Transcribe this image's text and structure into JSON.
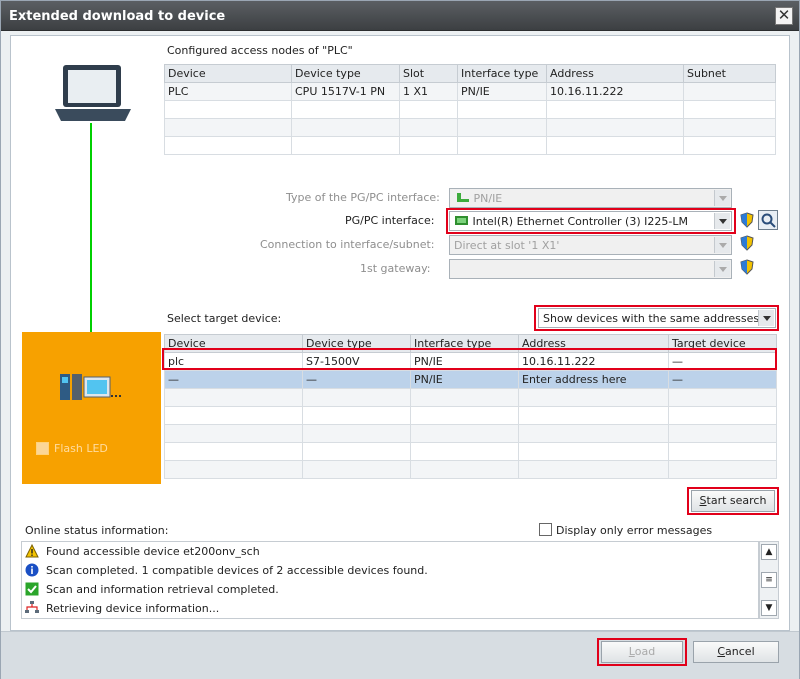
{
  "window": {
    "title": "Extended download to device",
    "close_glyph": "✕"
  },
  "configured": {
    "heading": "Configured access nodes of \"PLC\"",
    "columns": [
      "Device",
      "Device type",
      "Slot",
      "Interface type",
      "Address",
      "Subnet"
    ],
    "rows": [
      [
        "PLC",
        "CPU 1517V-1 PN",
        "1 X1",
        "PN/IE",
        "10.16.11.222",
        ""
      ]
    ]
  },
  "interface": {
    "type_label": "Type of the PG/PC interface:",
    "type_value": "PN/IE",
    "pgpc_label": "PG/PC interface:",
    "pgpc_value": "Intel(R) Ethernet Controller (3) I225-LM",
    "connection_label": "Connection to interface/subnet:",
    "connection_value": "Direct at slot '1 X1'",
    "gateway_label": "1st gateway:",
    "gateway_value": ""
  },
  "target": {
    "heading": "Select target device:",
    "filter_value": "Show devices with the same addresses",
    "columns": [
      "Device",
      "Device type",
      "Interface type",
      "Address",
      "Target device"
    ],
    "rows": [
      [
        "plc",
        "S7-1500V",
        "PN/IE",
        "10.16.11.222",
        "—"
      ],
      [
        "—",
        "—",
        "PN/IE",
        "Enter address here",
        "—"
      ]
    ]
  },
  "flash_led": {
    "label": "Flash LED"
  },
  "start_search": {
    "label_first": "S",
    "label_rest": "tart search"
  },
  "online": {
    "heading": "Online status information:",
    "only_errors_label": "Display only error messages",
    "messages": [
      {
        "icon": "warning-icon",
        "text": "Found accessible device et200onv_sch"
      },
      {
        "icon": "info-icon",
        "text": "Scan completed. 1 compatible devices of 2 accessible devices found."
      },
      {
        "icon": "check-icon",
        "text": "Scan and information retrieval completed."
      },
      {
        "icon": "network-icon",
        "text": "Retrieving device information..."
      }
    ]
  },
  "buttons": {
    "load_first": "L",
    "load_rest": "oad",
    "cancel_first": "C",
    "cancel_rest": "ancel"
  },
  "colors": {
    "accent_red": "#e1001a",
    "device_panel": "#f7a100",
    "link_line": "#00d000"
  }
}
